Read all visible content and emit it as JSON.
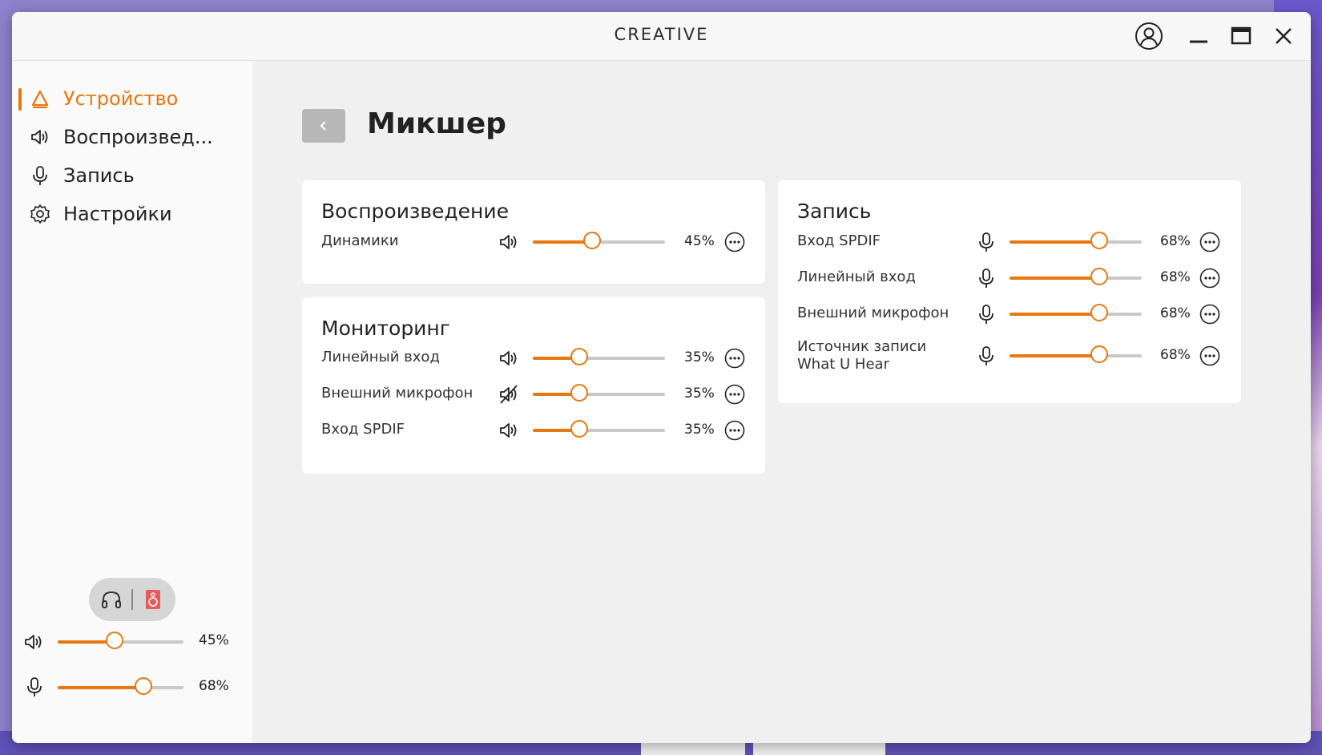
{
  "window": {
    "logo": "CREATIVE"
  },
  "sidebar": {
    "items": [
      {
        "label": "Устройство",
        "icon": "device-icon",
        "active": true
      },
      {
        "label": "Воспроизвед...",
        "icon": "speaker-icon",
        "active": false
      },
      {
        "label": "Запись",
        "icon": "microphone-icon",
        "active": false
      },
      {
        "label": "Настройки",
        "icon": "gear-icon",
        "active": false
      }
    ],
    "master": {
      "playback": {
        "value": 45,
        "label": "45%"
      },
      "recording": {
        "value": 68,
        "label": "68%"
      }
    }
  },
  "main": {
    "title": "Микшер",
    "playback": {
      "title": "Воспроизведение",
      "rows": [
        {
          "label": "Динамики",
          "value": 45,
          "pct": "45%",
          "icon": "speaker-icon"
        }
      ]
    },
    "monitoring": {
      "title": "Мониторинг",
      "rows": [
        {
          "label": "Линейный вход",
          "value": 35,
          "pct": "35%",
          "icon": "speaker-icon"
        },
        {
          "label": "Внешний микрофон",
          "value": 35,
          "pct": "35%",
          "icon": "speaker-muted-icon"
        },
        {
          "label": "Вход SPDIF",
          "value": 35,
          "pct": "35%",
          "icon": "speaker-icon"
        }
      ]
    },
    "recording": {
      "title": "Запись",
      "rows": [
        {
          "label": "Вход SPDIF",
          "value": 68,
          "pct": "68%",
          "icon": "microphone-icon"
        },
        {
          "label": "Линейный вход",
          "value": 68,
          "pct": "68%",
          "icon": "microphone-icon"
        },
        {
          "label": "Внешний микрофон",
          "value": 68,
          "pct": "68%",
          "icon": "microphone-icon"
        },
        {
          "label_line1": "Источник записи",
          "label_line2": "What U Hear",
          "value": 68,
          "pct": "68%",
          "icon": "microphone-icon"
        }
      ]
    }
  },
  "colors": {
    "accent": "#e8770f",
    "track": "#c8c8c8",
    "speaker_red": "#e85a5a"
  }
}
